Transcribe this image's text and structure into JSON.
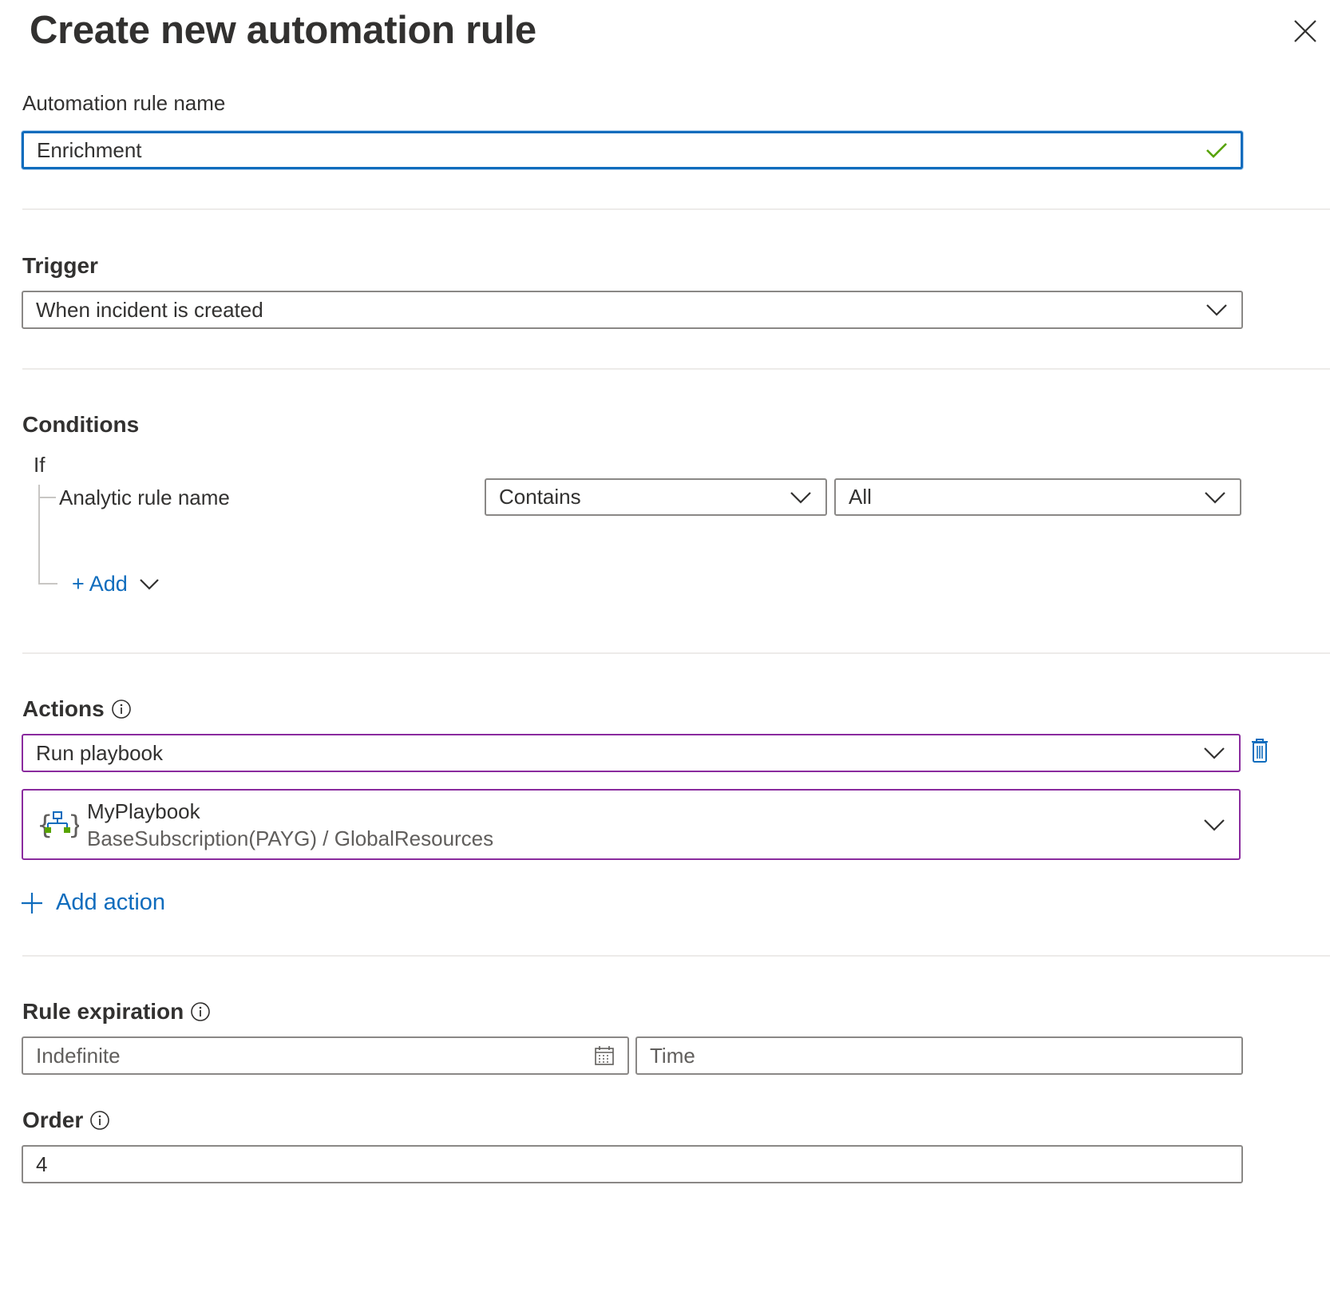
{
  "title": "Create new automation rule",
  "name_field": {
    "label": "Automation rule name",
    "value": "Enrichment"
  },
  "trigger": {
    "heading": "Trigger",
    "selected": "When incident is created"
  },
  "conditions": {
    "heading": "Conditions",
    "if_label": "If",
    "rows": [
      {
        "property": "Analytic rule name",
        "operator": "Contains",
        "value": "All"
      }
    ],
    "add_label": "+ Add"
  },
  "actions": {
    "heading": "Actions",
    "action_type": "Run playbook",
    "playbook": {
      "name": "MyPlaybook",
      "subtitle": "BaseSubscription(PAYG) / GlobalResources"
    },
    "add_action_label": "Add action"
  },
  "expiration": {
    "heading": "Rule expiration",
    "date_placeholder": "Indefinite",
    "time_placeholder": "Time"
  },
  "order": {
    "heading": "Order",
    "value": "4"
  },
  "colors": {
    "accent": "#0f6cbd",
    "valid": "#57a300",
    "action_border": "#8a2b9e"
  }
}
